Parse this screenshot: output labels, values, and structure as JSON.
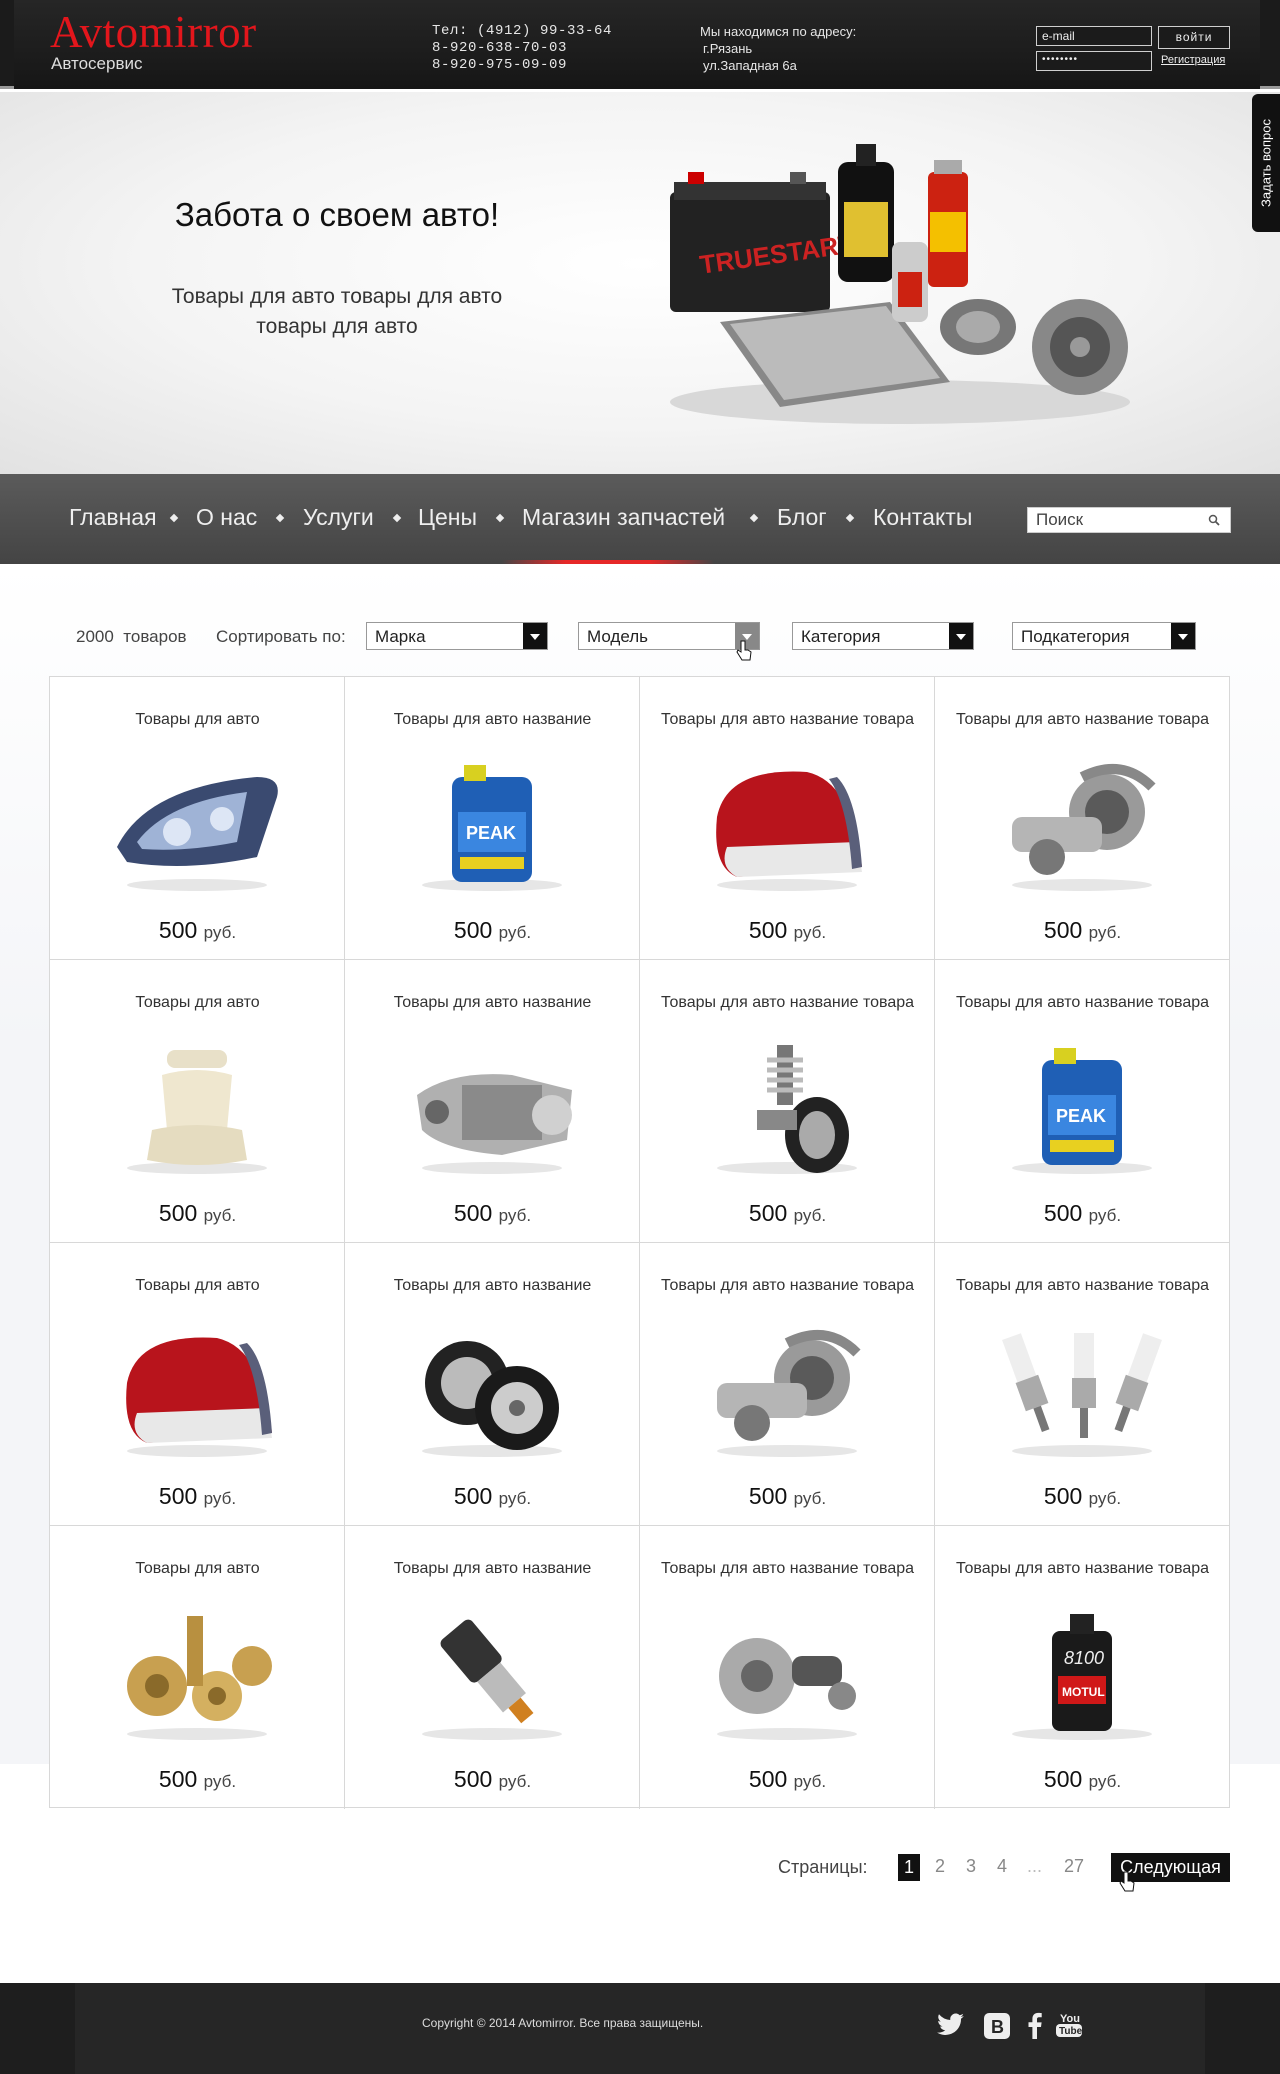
{
  "header": {
    "logo": "Avtomirror",
    "logo_sub": "Автосервис",
    "phones": [
      "Тел: (4912) 99-33-64",
      "8-920-638-70-03",
      "8-920-975-09-09"
    ],
    "address": [
      "Мы находимся по адресу:",
      "г.Рязань",
      "ул.Западная 6а"
    ],
    "email_placeholder": "e-mail",
    "password_value": "••••••••",
    "login_label": "войти",
    "register_label": "Регистрация"
  },
  "side_tab": "Задать вопрос",
  "hero": {
    "title": "Забота о своем авто!",
    "text": "Товары для авто товары для авто товары для авто"
  },
  "nav": {
    "items": [
      "Главная",
      "О нас",
      "Услуги",
      "Цены",
      "Магазин запчастей",
      "Блог",
      "Контакты"
    ],
    "active": "Магазин запчастей",
    "search_placeholder": "Поиск"
  },
  "filters": {
    "count": "2000",
    "count_label": "товаров",
    "sort_label": "Сортировать по:",
    "selects": [
      "Марка",
      "Модель",
      "Категория",
      "Подкатегория"
    ]
  },
  "products": [
    {
      "title": "Товары для авто",
      "price": "500",
      "currency": "руб.",
      "icon": "headlight"
    },
    {
      "title": "Товары для авто название",
      "price": "500",
      "currency": "руб.",
      "icon": "coolant"
    },
    {
      "title": "Товары для авто название товара",
      "price": "500",
      "currency": "руб.",
      "icon": "taillight"
    },
    {
      "title": "Товары для авто название товара",
      "price": "500",
      "currency": "руб.",
      "icon": "turbo"
    },
    {
      "title": "Товары для авто",
      "price": "500",
      "currency": "руб.",
      "icon": "seat"
    },
    {
      "title": "Товары для авто название",
      "price": "500",
      "currency": "руб.",
      "icon": "transmission"
    },
    {
      "title": "Товары для авто название товара",
      "price": "500",
      "currency": "руб.",
      "icon": "suspension"
    },
    {
      "title": "Товары для авто название товара",
      "price": "500",
      "currency": "руб.",
      "icon": "coolant"
    },
    {
      "title": "Товары для авто",
      "price": "500",
      "currency": "руб.",
      "icon": "taillight"
    },
    {
      "title": "Товары для авто название",
      "price": "500",
      "currency": "руб.",
      "icon": "wheels"
    },
    {
      "title": "Товары для авто название товара",
      "price": "500",
      "currency": "руб.",
      "icon": "turbo"
    },
    {
      "title": "Товары для авто название товара",
      "price": "500",
      "currency": "руб.",
      "icon": "spark-plugs"
    },
    {
      "title": "Товары для авто",
      "price": "500",
      "currency": "руб.",
      "icon": "gears"
    },
    {
      "title": "Товары для авто название",
      "price": "500",
      "currency": "руб.",
      "icon": "injector"
    },
    {
      "title": "Товары для авто название товара",
      "price": "500",
      "currency": "руб.",
      "icon": "brakes"
    },
    {
      "title": "Товары для авто название товара",
      "price": "500",
      "currency": "руб.",
      "icon": "oil"
    }
  ],
  "pagination": {
    "label": "Страницы:",
    "pages": [
      "1",
      "2",
      "3",
      "4",
      "...",
      "27"
    ],
    "current": "1",
    "next_label": "Следующая"
  },
  "footer": {
    "copyright": "Copyright © 2014 Avtomirror. Все права защищены.",
    "social": [
      "twitter-icon",
      "vk-icon",
      "facebook-icon",
      "youtube-icon"
    ]
  },
  "colors": {
    "accent": "#e3161c",
    "dark": "#1b1b1b",
    "nav": "#4f4f4f"
  }
}
